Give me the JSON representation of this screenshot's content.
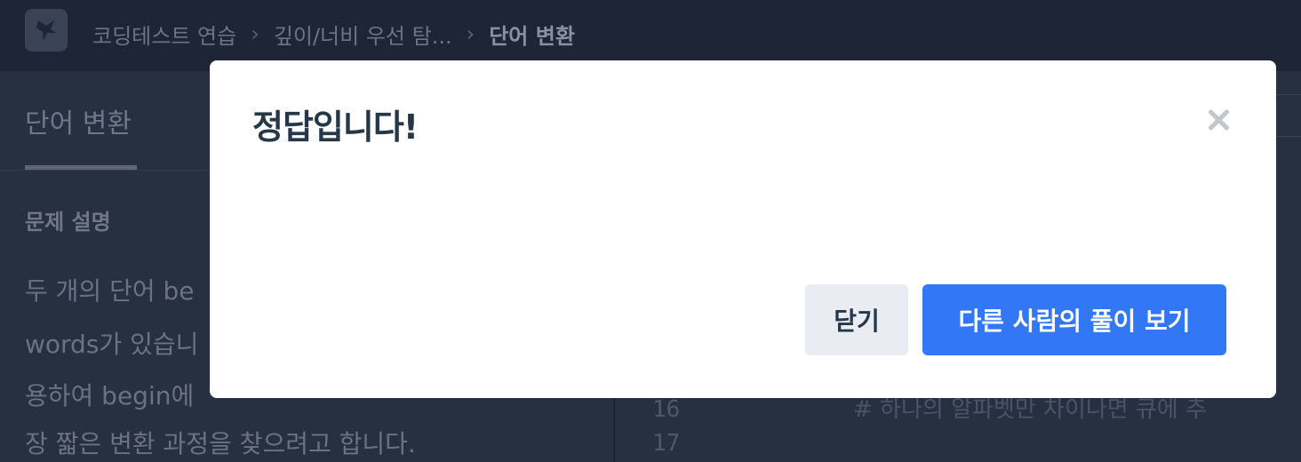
{
  "header": {
    "breadcrumbs": [
      "코딩테스트 연습",
      "깊이/너비 우선 탐...",
      "단어 변환"
    ]
  },
  "problem": {
    "tab_label": "단어 변환",
    "section_title": "문제 설명",
    "description_lines": [
      "두 개의 단어 be",
      "words가 있습니",
      "용하여 begin에",
      "장 짧은 변환 과정을 찾으려고 합니다."
    ]
  },
  "editor": {
    "line_numbers": [
      "16",
      "17"
    ],
    "code_line": "#  하나의  알파벳만  차이나면  큐에  추"
  },
  "modal": {
    "title": "정답입니다!",
    "close_button_label": "닫기",
    "primary_button_label": "다른 사람의 풀이 보기",
    "close_icon": "close-icon"
  },
  "colors": {
    "primary": "#3277f5",
    "secondary_button": "#e9ecf3",
    "title_text": "#263747",
    "backdrop": "#263041"
  }
}
